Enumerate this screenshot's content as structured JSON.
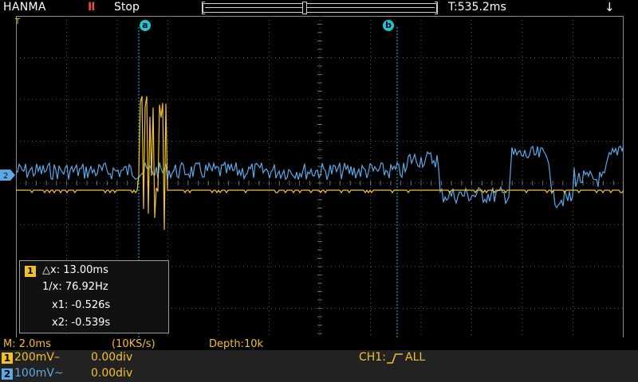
{
  "top": {
    "brand": "HANMA",
    "run_icon": "II",
    "run_state": "Stop",
    "trigger_time": "T:535.2ms",
    "usb_icon": "usb-icon"
  },
  "cursors": {
    "a_label": "a",
    "b_label": "b"
  },
  "markers": {
    "trigger": "T",
    "ch2": "2"
  },
  "measure": {
    "channel": "1",
    "dx": "△x: 13.00ms",
    "inv_dx": "1/x: 76.92Hz",
    "x1": "x1: -0.526s",
    "x2": "x2: -0.539s"
  },
  "status": {
    "timebase": "M: 2.0ms",
    "sample_rate": "(10KS/s)",
    "depth": "Depth:10k"
  },
  "channels": [
    {
      "num": "1",
      "scale": "200mV–",
      "offset": "0.00div",
      "color": "#f2c028"
    },
    {
      "num": "2",
      "scale": "100mV~",
      "offset": "0.00div",
      "color": "#5aa8e6"
    }
  ],
  "trigger": {
    "label": "CH1:",
    "edge_icon": "rising-edge-icon",
    "mode": "ALL"
  },
  "colors": {
    "ch1": "#f2c028",
    "ch2": "#5aa8e6",
    "cursor": "#1ec5d7",
    "stop": "#e84c3d"
  }
}
